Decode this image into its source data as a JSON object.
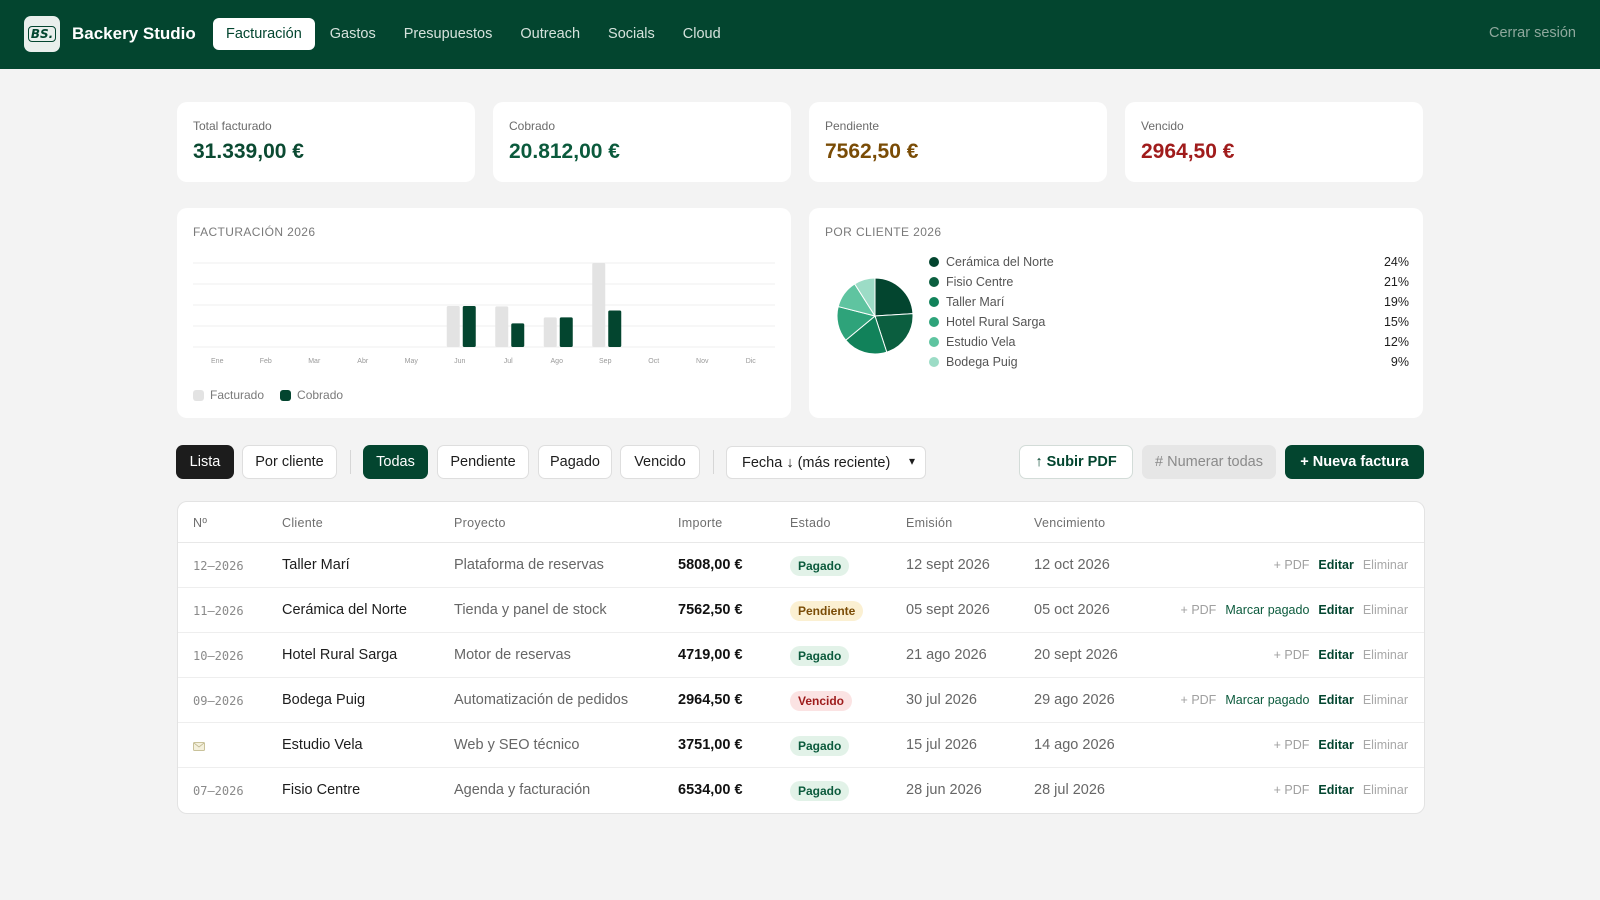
{
  "app": {
    "logo_text": "BS.",
    "brand": "Backery Studio",
    "nav": [
      {
        "label": "Facturación",
        "active": true
      },
      {
        "label": "Gastos",
        "active": false
      },
      {
        "label": "Presupuestos",
        "active": false
      },
      {
        "label": "Outreach",
        "active": false
      },
      {
        "label": "Socials",
        "active": false
      },
      {
        "label": "Cloud",
        "active": false
      }
    ],
    "logout": "Cerrar sesión"
  },
  "kpis": [
    {
      "label": "Total facturado",
      "value": "31.339,00 €",
      "color": "#0b4a32"
    },
    {
      "label": "Cobrado",
      "value": "20.812,00 €",
      "color": "#0b5a3c"
    },
    {
      "label": "Pendiente",
      "value": "7562,50 €",
      "color": "#7a4c06"
    },
    {
      "label": "Vencido",
      "value": "2964,50 €",
      "color": "#a01c1c"
    }
  ],
  "chart_data": [
    {
      "type": "bar",
      "title": "FACTURACIÓN 2026",
      "categories": [
        "Ene",
        "Feb",
        "Mar",
        "Abr",
        "May",
        "Jun",
        "Jul",
        "Ago",
        "Sep",
        "Oct",
        "Nov",
        "Dic"
      ],
      "series": [
        {
          "name": "Facturado",
          "color": "#e3e3e3",
          "values": [
            0,
            0,
            0,
            0,
            0,
            6534,
            6470,
            4719,
            13370,
            0,
            0,
            0
          ]
        },
        {
          "name": "Cobrado",
          "color": "#03452f",
          "values": [
            0,
            0,
            0,
            0,
            0,
            6534,
            3751,
            4719,
            5808,
            0,
            0,
            0
          ]
        }
      ],
      "ylim": [
        0,
        13370
      ],
      "grid": true,
      "legend": "bottom-left"
    },
    {
      "type": "pie",
      "title": "POR CLIENTE 2026",
      "slices": [
        {
          "label": "Cerámica del Norte",
          "value": 24,
          "pct": "24%",
          "color": "#03452f"
        },
        {
          "label": "Fisio Centre",
          "value": 21,
          "pct": "21%",
          "color": "#0b5e3f"
        },
        {
          "label": "Taller Marí",
          "value": 19,
          "pct": "19%",
          "color": "#11825a"
        },
        {
          "label": "Hotel Rural Sarga",
          "value": 15,
          "pct": "15%",
          "color": "#2ea37a"
        },
        {
          "label": "Estudio Vela",
          "value": 12,
          "pct": "12%",
          "color": "#5fc4a0"
        },
        {
          "label": "Bodega Puig",
          "value": 9,
          "pct": "9%",
          "color": "#9cdcc6"
        }
      ],
      "legend": "right"
    }
  ],
  "toolbar": {
    "view_lista": "Lista",
    "view_cliente": "Por cliente",
    "filters": [
      "Todas",
      "Pendiente",
      "Pagado",
      "Vencido"
    ],
    "sort_label": "Fecha ↓ (más reciente)",
    "upload_pdf": "↑ Subir PDF",
    "number_all": "# Numerar todas",
    "new_invoice": "+ Nueva factura"
  },
  "table": {
    "headers": {
      "num": "Nº",
      "cliente": "Cliente",
      "proyecto": "Proyecto",
      "importe": "Importe",
      "estado": "Estado",
      "emision": "Emisión",
      "vencimiento": "Vencimiento"
    },
    "actions": {
      "pdf": "+ PDF",
      "mark": "Marcar pagado",
      "edit": "Editar",
      "delete": "Eliminar"
    },
    "rows": [
      {
        "num": "12–2026",
        "cliente": "Taller Marí",
        "proyecto": "Plataforma de reservas",
        "importe": "5808,00 €",
        "estado": "Pagado",
        "emision": "12 sept 2026",
        "vencimiento": "12 oct 2026"
      },
      {
        "num": "11–2026",
        "cliente": "Cerámica del Norte",
        "proyecto": "Tienda y panel de stock",
        "importe": "7562,50 €",
        "estado": "Pendiente",
        "emision": "05 sept 2026",
        "vencimiento": "05 oct 2026"
      },
      {
        "num": "10–2026",
        "cliente": "Hotel Rural Sarga",
        "proyecto": "Motor de reservas",
        "importe": "4719,00 €",
        "estado": "Pagado",
        "emision": "21 ago 2026",
        "vencimiento": "20 sept 2026"
      },
      {
        "num": "09–2026",
        "cliente": "Bodega Puig",
        "proyecto": "Automatización de pedidos",
        "importe": "2964,50 €",
        "estado": "Vencido",
        "emision": "30 jul 2026",
        "vencimiento": "29 ago 2026"
      },
      {
        "num": "",
        "cliente": "Estudio Vela",
        "proyecto": "Web y SEO técnico",
        "importe": "3751,00 €",
        "estado": "Pagado",
        "emision": "15 jul 2026",
        "vencimiento": "14 ago 2026"
      },
      {
        "num": "07–2026",
        "cliente": "Fisio Centre",
        "proyecto": "Agenda y facturación",
        "importe": "6534,00 €",
        "estado": "Pagado",
        "emision": "28 jun 2026",
        "vencimiento": "28 jul 2026"
      }
    ]
  }
}
